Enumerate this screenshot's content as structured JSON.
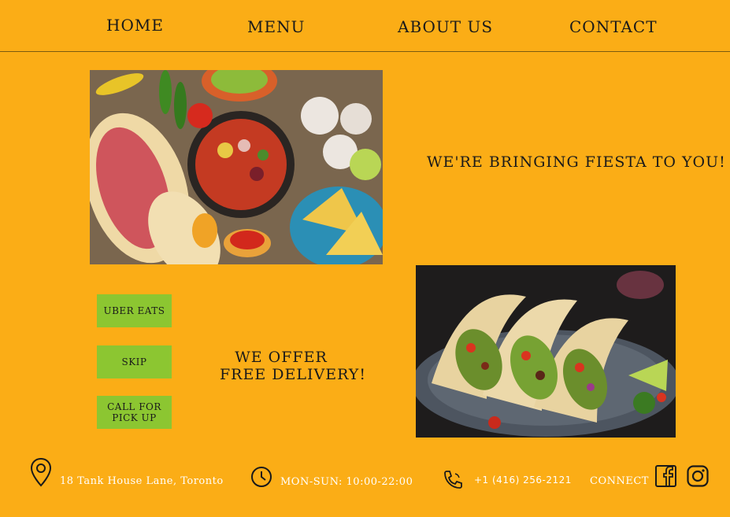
{
  "nav": {
    "home": "HOME",
    "menu": "MENU",
    "about": "ABOUT US",
    "contact": "CONTACT"
  },
  "hero": {
    "tagline": "WE'RE BRINGING FIESTA TO YOU!"
  },
  "delivery": {
    "line1": "WE OFFER",
    "line2": "FREE DELIVERY!"
  },
  "buttons": {
    "uber_eats": "UBER EATS",
    "skip": "SKIP",
    "call_line1": "CALL FOR",
    "call_line2": "PICK UP"
  },
  "footer": {
    "address": "18 Tank House Lane, Toronto",
    "hours": "MON-SUN: 10:00-22:00",
    "phone": "+1 (416) 256-2121",
    "connect": "CONNECT"
  },
  "icons": {
    "location": "location-pin-icon",
    "clock": "clock-icon",
    "phone": "phone-icon",
    "facebook": "facebook-icon",
    "instagram": "instagram-icon"
  },
  "colors": {
    "background": "#fbad16",
    "button": "#8cc631",
    "footer_text": "#ffffff",
    "text": "#1a1a1a"
  }
}
